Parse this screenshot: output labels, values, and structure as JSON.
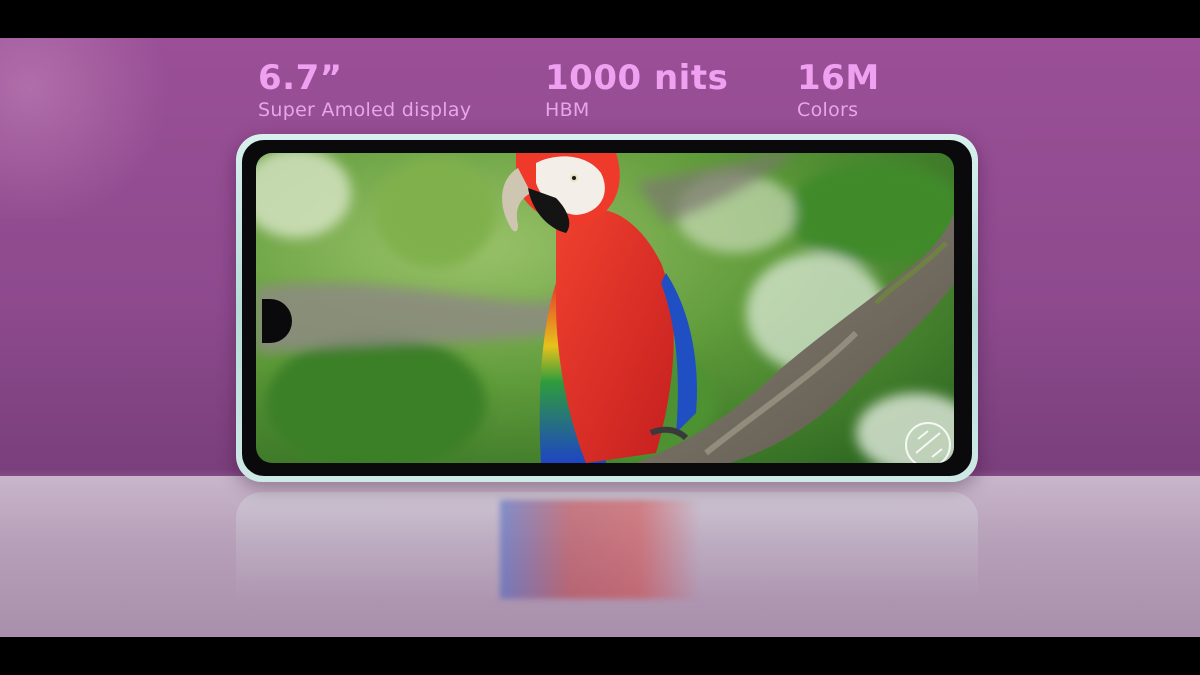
{
  "specs": [
    {
      "value": "6.7”",
      "label": "Super Amoled display"
    },
    {
      "value": "1000 nits",
      "label": "HBM"
    },
    {
      "value": "16M",
      "label": "Colors"
    }
  ],
  "colors": {
    "background": "#8d4a8d",
    "accent_text": "#f0a0f0",
    "phone_frame": "#cfe9e6"
  },
  "icons": [
    "rotate-icon"
  ]
}
